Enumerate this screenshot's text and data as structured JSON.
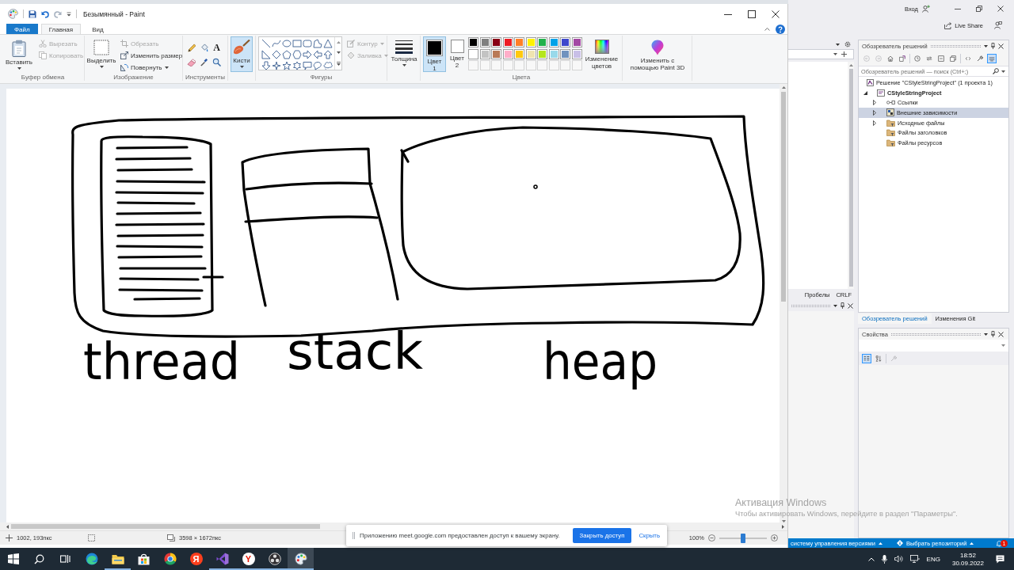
{
  "paint": {
    "title": "Безымянный - Paint",
    "tabs": [
      {
        "label": "Файл",
        "kind": "file",
        "selected": false
      },
      {
        "label": "Главная",
        "kind": "ribbon",
        "selected": true
      },
      {
        "label": "Вид",
        "kind": "ribbon",
        "selected": false
      }
    ],
    "ribbon": {
      "clipboard": {
        "label": "Буфер обмена",
        "paste": "Вставить",
        "cut": {
          "label": "Вырезать",
          "disabled": true
        },
        "copy": {
          "label": "Копировать",
          "disabled": true
        }
      },
      "image": {
        "label": "Изображение",
        "select": "Выделить",
        "crop": {
          "label": "Обрезать",
          "disabled": true
        },
        "resize": {
          "label": "Изменить размер",
          "disabled": false
        },
        "rotate": {
          "label": "Повернуть",
          "disabled": false
        }
      },
      "tools": {
        "label": "Инструменты",
        "items": [
          {
            "kind": "pencil",
            "selected": false
          },
          {
            "kind": "fill",
            "selected": false
          },
          {
            "kind": "text",
            "glyph": "A",
            "selected": false
          },
          {
            "kind": "eraser",
            "selected": false
          },
          {
            "kind": "picker",
            "selected": false
          },
          {
            "kind": "magnifier",
            "selected": false
          }
        ]
      },
      "brushes": {
        "label": "Кисти",
        "selected": true
      },
      "shapes": {
        "label": "Фигуры",
        "outline": {
          "label": "Контур",
          "disabled": true
        },
        "fill": {
          "label": "Заливка",
          "disabled": true
        }
      },
      "size": {
        "label": "Толщина"
      },
      "colors": {
        "label": "Цвета",
        "color1": {
          "label": "Цвет 1",
          "color": "#000000",
          "selected": true
        },
        "color2": {
          "label": "Цвет 2",
          "color": "#ffffff",
          "selected": false
        },
        "palette": [
          {
            "kind": "color",
            "color": "#000000"
          },
          {
            "kind": "color",
            "color": "#7f7f7f"
          },
          {
            "kind": "color",
            "color": "#880015"
          },
          {
            "kind": "color",
            "color": "#ed1c24"
          },
          {
            "kind": "color",
            "color": "#ff7f27"
          },
          {
            "kind": "color",
            "color": "#fff200"
          },
          {
            "kind": "color",
            "color": "#22b14c"
          },
          {
            "kind": "color",
            "color": "#00a2e8"
          },
          {
            "kind": "color",
            "color": "#3f48cc"
          },
          {
            "kind": "color",
            "color": "#a349a4"
          },
          {
            "kind": "color",
            "color": "#ffffff"
          },
          {
            "kind": "color",
            "color": "#c3c3c3"
          },
          {
            "kind": "color",
            "color": "#b97a57"
          },
          {
            "kind": "color",
            "color": "#ffaec9"
          },
          {
            "kind": "color",
            "color": "#ffc90e"
          },
          {
            "kind": "color",
            "color": "#efe4b0"
          },
          {
            "kind": "color",
            "color": "#b5e61d"
          },
          {
            "kind": "color",
            "color": "#99d9ea"
          },
          {
            "kind": "color",
            "color": "#7092be"
          },
          {
            "kind": "color",
            "color": "#c8bfe7"
          },
          {
            "kind": "empty"
          },
          {
            "kind": "empty"
          },
          {
            "kind": "empty"
          },
          {
            "kind": "empty"
          },
          {
            "kind": "empty"
          },
          {
            "kind": "empty"
          },
          {
            "kind": "empty"
          },
          {
            "kind": "empty"
          },
          {
            "kind": "empty"
          },
          {
            "kind": "empty"
          }
        ],
        "edit": "Изменение цветов"
      },
      "paint3d": "Изменить с помощью Paint 3D"
    },
    "canvas": {
      "labels": [
        "thread",
        "stack",
        "heap"
      ]
    },
    "status_bar": {
      "cursor": "1002, 193пкс",
      "image_size": "3598 × 1672пкс",
      "zoom": "100%",
      "zoom_slider": {
        "level": 0.5
      }
    }
  },
  "visual_studio": {
    "account": "Вход",
    "live_share": "Live Share",
    "editor_status": {
      "indent": "Пробелы",
      "line_endings": "CRLF"
    },
    "solution_explorer": {
      "title": "Обозреватель решений",
      "toolbar": [
        {
          "kind": "back",
          "disabled": true,
          "on": false
        },
        {
          "kind": "forward",
          "disabled": true,
          "on": false
        },
        {
          "kind": "home",
          "disabled": false,
          "on": false
        },
        {
          "kind": "switch-views",
          "disabled": false,
          "on": false
        },
        {
          "kind": "history",
          "disabled": false,
          "on": false
        },
        {
          "kind": "sync",
          "disabled": false,
          "on": false
        },
        {
          "kind": "collapse",
          "disabled": false,
          "on": false
        },
        {
          "kind": "show-all",
          "disabled": false,
          "on": false
        },
        {
          "kind": "code",
          "disabled": false,
          "on": false
        },
        {
          "kind": "properties",
          "disabled": false,
          "on": false
        },
        {
          "kind": "preview",
          "disabled": false,
          "on": true
        }
      ],
      "search": {
        "placeholder": "Обозреватель решений — поиск (Ctrl+;)"
      },
      "tree": [
        {
          "label": "Решение \"CStyleStringProject\" (1 проекта 1)",
          "kind": "solution",
          "selected": false,
          "children": [
            {
              "label": "CStyleStringProject",
              "kind": "project",
              "expanded": true,
              "selected": false,
              "children": [
                {
                  "label": "Ссылки",
                  "kind": "references",
                  "expanded": false,
                  "selected": false
                },
                {
                  "label": "Внешние зависимости",
                  "kind": "dependencies",
                  "expanded": false,
                  "selected": true
                },
                {
                  "label": "Исходные файлы",
                  "kind": "filter",
                  "expanded": false,
                  "selected": false
                },
                {
                  "label": "Файлы заголовков",
                  "kind": "filter",
                  "selected": false
                },
                {
                  "label": "Файлы ресурсов",
                  "kind": "filter",
                  "selected": false
                }
              ]
            }
          ]
        }
      ]
    },
    "panel_tabs": [
      {
        "label": "Обозреватель решений",
        "selected": true
      },
      {
        "label": "Изменения Git",
        "selected": false
      }
    ],
    "properties": {
      "title": "Свойства",
      "toolbar": [
        {
          "kind": "categorized",
          "disabled": false,
          "on": true
        },
        {
          "kind": "alphabetical",
          "disabled": false,
          "on": false
        },
        {
          "kind": "property-pages",
          "disabled": true,
          "on": false
        }
      ]
    },
    "status_bar": {
      "source_control": "систему управления версиями",
      "repository": "Выбрать репозиторий",
      "notification_count": "1"
    }
  },
  "share_banner": {
    "message": "Приложению meet.google.com предоставлен доступ к вашему экрану.",
    "stop_button": "Закрыть доступ",
    "hide_link": "Скрыть"
  },
  "activation_notice": {
    "title": "Активация Windows",
    "text": "Чтобы активировать Windows, перейдите в раздел \"Параметры\"."
  },
  "taskbar": {
    "items": [
      {
        "kind": "start",
        "running": false,
        "selected": false
      },
      {
        "kind": "search",
        "running": false,
        "selected": false
      },
      {
        "kind": "task-view",
        "running": false,
        "selected": false
      },
      {
        "kind": "swirl",
        "running": false,
        "selected": false
      },
      {
        "kind": "folder",
        "running": true,
        "selected": false
      },
      {
        "kind": "store",
        "running": false,
        "selected": false
      },
      {
        "kind": "wheel",
        "running": false,
        "selected": false
      },
      {
        "kind": "letter",
        "glyph": "Я",
        "running": false,
        "selected": false
      },
      {
        "kind": "ide",
        "running": true,
        "selected": false
      },
      {
        "kind": "letter-inverse",
        "glyph": "Y",
        "running": true,
        "selected": false
      },
      {
        "kind": "recorder",
        "running": true,
        "selected": false
      },
      {
        "kind": "paint",
        "running": true,
        "selected": true
      }
    ],
    "tray": {
      "language": "ENG",
      "time": "18:52",
      "date": "30.09.2022"
    }
  }
}
